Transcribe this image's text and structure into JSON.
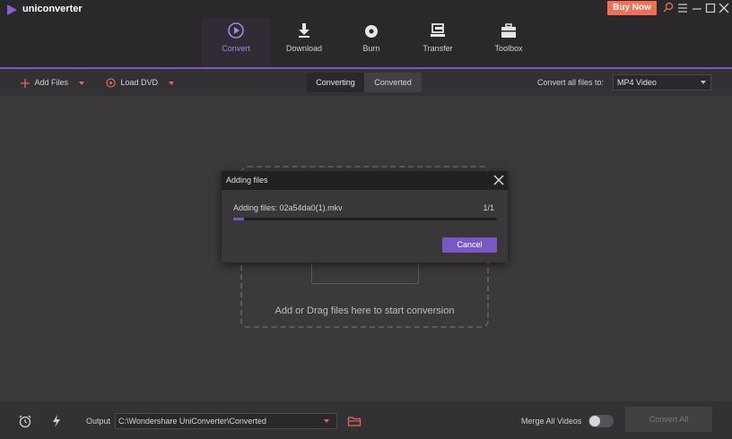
{
  "app": {
    "name": "uniconverter",
    "buy_now": "Buy Now"
  },
  "nav": {
    "tabs": [
      {
        "label": "Convert",
        "icon": "convert-icon",
        "active": true
      },
      {
        "label": "Download",
        "icon": "download-icon"
      },
      {
        "label": "Burn",
        "icon": "burn-icon"
      },
      {
        "label": "Transfer",
        "icon": "transfer-icon"
      },
      {
        "label": "Toolbox",
        "icon": "toolbox-icon"
      }
    ]
  },
  "toolbar": {
    "add_files": "Add Files",
    "load_dvd": "Load DVD",
    "seg_converting": "Converting",
    "seg_converted": "Converted",
    "convert_all_to_label": "Convert all files to:",
    "format_value": "MP4 Video"
  },
  "drop_zone": {
    "text": "Add or Drag files here to start conversion"
  },
  "dialog": {
    "title": "Adding files",
    "file_text": "Adding files: 02a54da0(1).mkv",
    "count": "1/1",
    "progress": 0.04,
    "cancel": "Cancel"
  },
  "bottom": {
    "output_label": "Output",
    "output_path": "C:\\Wondershare UniConverter\\Converted",
    "merge_label": "Merge All Videos",
    "merge_on": false,
    "convert_all": "Convert All"
  },
  "colors": {
    "accent": "#7b57c4",
    "buy_now": "#f07055"
  }
}
